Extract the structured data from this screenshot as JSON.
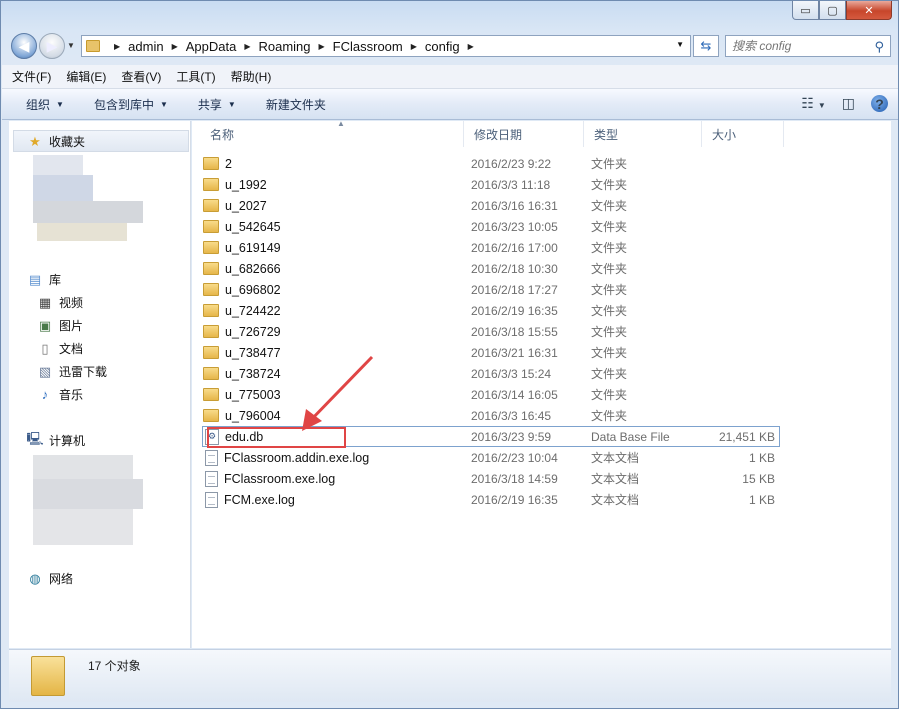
{
  "window": {
    "minimize_glyph": "▭",
    "maximize_glyph": "▢",
    "close_glyph": "✕"
  },
  "address_bar": {
    "breadcrumbs": [
      "admin",
      "AppData",
      "Roaming",
      "FClassroom",
      "config"
    ],
    "search_placeholder": "搜索 config"
  },
  "menu": [
    "文件(F)",
    "编辑(E)",
    "查看(V)",
    "工具(T)",
    "帮助(H)"
  ],
  "commands": [
    "组织",
    "包含到库中",
    "共享",
    "新建文件夹"
  ],
  "nav": {
    "favorites": "收藏夹",
    "libraries": "库",
    "library_items": [
      "视频",
      "图片",
      "文档",
      "迅雷下载",
      "音乐"
    ],
    "computer": "计算机",
    "network": "网络"
  },
  "columns": [
    "名称",
    "修改日期",
    "类型",
    "大小"
  ],
  "files": [
    {
      "name": "2",
      "date": "2016/2/23 9:22",
      "type": "文件夹",
      "size": "",
      "kind": "folder"
    },
    {
      "name": "u_1992",
      "date": "2016/3/3 11:18",
      "type": "文件夹",
      "size": "",
      "kind": "folder"
    },
    {
      "name": "u_2027",
      "date": "2016/3/16 16:31",
      "type": "文件夹",
      "size": "",
      "kind": "folder"
    },
    {
      "name": "u_542645",
      "date": "2016/3/23 10:05",
      "type": "文件夹",
      "size": "",
      "kind": "folder"
    },
    {
      "name": "u_619149",
      "date": "2016/2/16 17:00",
      "type": "文件夹",
      "size": "",
      "kind": "folder"
    },
    {
      "name": "u_682666",
      "date": "2016/2/18 10:30",
      "type": "文件夹",
      "size": "",
      "kind": "folder"
    },
    {
      "name": "u_696802",
      "date": "2016/2/18 17:27",
      "type": "文件夹",
      "size": "",
      "kind": "folder"
    },
    {
      "name": "u_724422",
      "date": "2016/2/19 16:35",
      "type": "文件夹",
      "size": "",
      "kind": "folder"
    },
    {
      "name": "u_726729",
      "date": "2016/3/18 15:55",
      "type": "文件夹",
      "size": "",
      "kind": "folder"
    },
    {
      "name": "u_738477",
      "date": "2016/3/21 16:31",
      "type": "文件夹",
      "size": "",
      "kind": "folder"
    },
    {
      "name": "u_738724",
      "date": "2016/3/3 15:24",
      "type": "文件夹",
      "size": "",
      "kind": "folder"
    },
    {
      "name": "u_775003",
      "date": "2016/3/14 16:05",
      "type": "文件夹",
      "size": "",
      "kind": "folder"
    },
    {
      "name": "u_796004",
      "date": "2016/3/3 16:45",
      "type": "文件夹",
      "size": "",
      "kind": "folder"
    },
    {
      "name": "edu.db",
      "date": "2016/3/23 9:59",
      "type": "Data Base File",
      "size": "21,451 KB",
      "kind": "db",
      "selected": true
    },
    {
      "name": "FClassroom.addin.exe.log",
      "date": "2016/2/23 10:04",
      "type": "文本文档",
      "size": "1 KB",
      "kind": "doc"
    },
    {
      "name": "FClassroom.exe.log",
      "date": "2016/3/18 14:59",
      "type": "文本文档",
      "size": "15 KB",
      "kind": "doc"
    },
    {
      "name": "FCM.exe.log",
      "date": "2016/2/19 16:35",
      "type": "文本文档",
      "size": "1 KB",
      "kind": "doc"
    }
  ],
  "status": {
    "item_count": "17 个对象"
  },
  "colors": {
    "annotation": "#e04545",
    "selection_border": "#7da2ce"
  }
}
